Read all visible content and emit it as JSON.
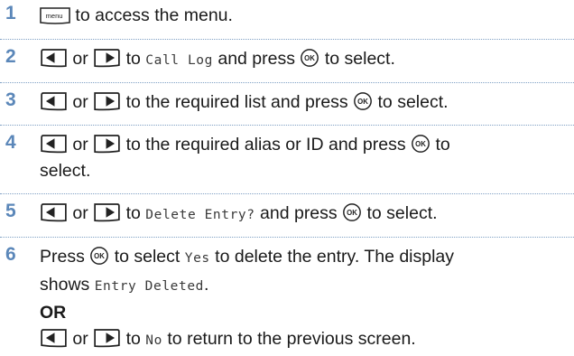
{
  "steps": [
    {
      "num": "1",
      "menu_key": "menu",
      "text": "to access the menu."
    },
    {
      "num": "2",
      "or": "or",
      "to": "to",
      "target": "Call Log",
      "and_press": "and press",
      "ok": "OK",
      "end": "to select."
    },
    {
      "num": "3",
      "or": "or",
      "text": "to the required list and press",
      "ok": "OK",
      "end": "to select."
    },
    {
      "num": "4",
      "or": "or",
      "text": "to the required alias or ID and press",
      "ok": "OK",
      "to2": "to",
      "cont": "select."
    },
    {
      "num": "5",
      "or": "or",
      "to": "to",
      "target": "Delete Entry?",
      "and_press": "and press",
      "ok": "OK",
      "end": "to select."
    },
    {
      "num": "6",
      "press": "Press",
      "ok": "OK",
      "to_select": "to select",
      "yes": "Yes",
      "rest": "to delete the entry. The display",
      "shows": "shows",
      "deleted": "Entry Deleted",
      "period": ".",
      "or_label": "OR",
      "or": "or",
      "to": "to",
      "no": "No",
      "no_rest": "to return to the previous screen."
    }
  ],
  "colors": {
    "number": "#5b87b9",
    "separator": "#7fa0c4"
  }
}
